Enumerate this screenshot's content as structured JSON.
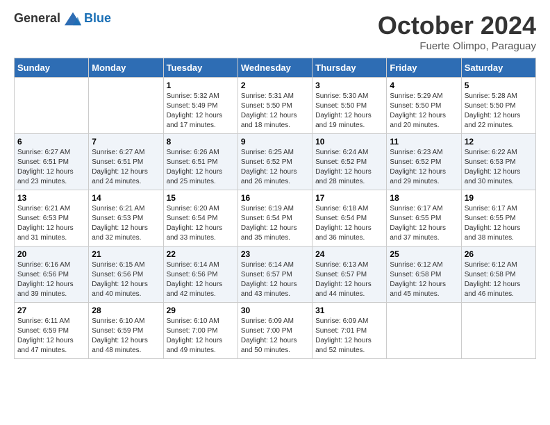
{
  "header": {
    "logo": {
      "general": "General",
      "blue": "Blue"
    },
    "title": "October 2024",
    "location": "Fuerte Olimpo, Paraguay"
  },
  "weekdays": [
    "Sunday",
    "Monday",
    "Tuesday",
    "Wednesday",
    "Thursday",
    "Friday",
    "Saturday"
  ],
  "weeks": [
    [
      {
        "day": "",
        "sunrise": "",
        "sunset": "",
        "daylight": ""
      },
      {
        "day": "",
        "sunrise": "",
        "sunset": "",
        "daylight": ""
      },
      {
        "day": "1",
        "sunrise": "Sunrise: 5:32 AM",
        "sunset": "Sunset: 5:49 PM",
        "daylight": "Daylight: 12 hours and 17 minutes."
      },
      {
        "day": "2",
        "sunrise": "Sunrise: 5:31 AM",
        "sunset": "Sunset: 5:50 PM",
        "daylight": "Daylight: 12 hours and 18 minutes."
      },
      {
        "day": "3",
        "sunrise": "Sunrise: 5:30 AM",
        "sunset": "Sunset: 5:50 PM",
        "daylight": "Daylight: 12 hours and 19 minutes."
      },
      {
        "day": "4",
        "sunrise": "Sunrise: 5:29 AM",
        "sunset": "Sunset: 5:50 PM",
        "daylight": "Daylight: 12 hours and 20 minutes."
      },
      {
        "day": "5",
        "sunrise": "Sunrise: 5:28 AM",
        "sunset": "Sunset: 5:50 PM",
        "daylight": "Daylight: 12 hours and 22 minutes."
      }
    ],
    [
      {
        "day": "6",
        "sunrise": "Sunrise: 6:27 AM",
        "sunset": "Sunset: 6:51 PM",
        "daylight": "Daylight: 12 hours and 23 minutes."
      },
      {
        "day": "7",
        "sunrise": "Sunrise: 6:27 AM",
        "sunset": "Sunset: 6:51 PM",
        "daylight": "Daylight: 12 hours and 24 minutes."
      },
      {
        "day": "8",
        "sunrise": "Sunrise: 6:26 AM",
        "sunset": "Sunset: 6:51 PM",
        "daylight": "Daylight: 12 hours and 25 minutes."
      },
      {
        "day": "9",
        "sunrise": "Sunrise: 6:25 AM",
        "sunset": "Sunset: 6:52 PM",
        "daylight": "Daylight: 12 hours and 26 minutes."
      },
      {
        "day": "10",
        "sunrise": "Sunrise: 6:24 AM",
        "sunset": "Sunset: 6:52 PM",
        "daylight": "Daylight: 12 hours and 28 minutes."
      },
      {
        "day": "11",
        "sunrise": "Sunrise: 6:23 AM",
        "sunset": "Sunset: 6:52 PM",
        "daylight": "Daylight: 12 hours and 29 minutes."
      },
      {
        "day": "12",
        "sunrise": "Sunrise: 6:22 AM",
        "sunset": "Sunset: 6:53 PM",
        "daylight": "Daylight: 12 hours and 30 minutes."
      }
    ],
    [
      {
        "day": "13",
        "sunrise": "Sunrise: 6:21 AM",
        "sunset": "Sunset: 6:53 PM",
        "daylight": "Daylight: 12 hours and 31 minutes."
      },
      {
        "day": "14",
        "sunrise": "Sunrise: 6:21 AM",
        "sunset": "Sunset: 6:53 PM",
        "daylight": "Daylight: 12 hours and 32 minutes."
      },
      {
        "day": "15",
        "sunrise": "Sunrise: 6:20 AM",
        "sunset": "Sunset: 6:54 PM",
        "daylight": "Daylight: 12 hours and 33 minutes."
      },
      {
        "day": "16",
        "sunrise": "Sunrise: 6:19 AM",
        "sunset": "Sunset: 6:54 PM",
        "daylight": "Daylight: 12 hours and 35 minutes."
      },
      {
        "day": "17",
        "sunrise": "Sunrise: 6:18 AM",
        "sunset": "Sunset: 6:54 PM",
        "daylight": "Daylight: 12 hours and 36 minutes."
      },
      {
        "day": "18",
        "sunrise": "Sunrise: 6:17 AM",
        "sunset": "Sunset: 6:55 PM",
        "daylight": "Daylight: 12 hours and 37 minutes."
      },
      {
        "day": "19",
        "sunrise": "Sunrise: 6:17 AM",
        "sunset": "Sunset: 6:55 PM",
        "daylight": "Daylight: 12 hours and 38 minutes."
      }
    ],
    [
      {
        "day": "20",
        "sunrise": "Sunrise: 6:16 AM",
        "sunset": "Sunset: 6:56 PM",
        "daylight": "Daylight: 12 hours and 39 minutes."
      },
      {
        "day": "21",
        "sunrise": "Sunrise: 6:15 AM",
        "sunset": "Sunset: 6:56 PM",
        "daylight": "Daylight: 12 hours and 40 minutes."
      },
      {
        "day": "22",
        "sunrise": "Sunrise: 6:14 AM",
        "sunset": "Sunset: 6:56 PM",
        "daylight": "Daylight: 12 hours and 42 minutes."
      },
      {
        "day": "23",
        "sunrise": "Sunrise: 6:14 AM",
        "sunset": "Sunset: 6:57 PM",
        "daylight": "Daylight: 12 hours and 43 minutes."
      },
      {
        "day": "24",
        "sunrise": "Sunrise: 6:13 AM",
        "sunset": "Sunset: 6:57 PM",
        "daylight": "Daylight: 12 hours and 44 minutes."
      },
      {
        "day": "25",
        "sunrise": "Sunrise: 6:12 AM",
        "sunset": "Sunset: 6:58 PM",
        "daylight": "Daylight: 12 hours and 45 minutes."
      },
      {
        "day": "26",
        "sunrise": "Sunrise: 6:12 AM",
        "sunset": "Sunset: 6:58 PM",
        "daylight": "Daylight: 12 hours and 46 minutes."
      }
    ],
    [
      {
        "day": "27",
        "sunrise": "Sunrise: 6:11 AM",
        "sunset": "Sunset: 6:59 PM",
        "daylight": "Daylight: 12 hours and 47 minutes."
      },
      {
        "day": "28",
        "sunrise": "Sunrise: 6:10 AM",
        "sunset": "Sunset: 6:59 PM",
        "daylight": "Daylight: 12 hours and 48 minutes."
      },
      {
        "day": "29",
        "sunrise": "Sunrise: 6:10 AM",
        "sunset": "Sunset: 7:00 PM",
        "daylight": "Daylight: 12 hours and 49 minutes."
      },
      {
        "day": "30",
        "sunrise": "Sunrise: 6:09 AM",
        "sunset": "Sunset: 7:00 PM",
        "daylight": "Daylight: 12 hours and 50 minutes."
      },
      {
        "day": "31",
        "sunrise": "Sunrise: 6:09 AM",
        "sunset": "Sunset: 7:01 PM",
        "daylight": "Daylight: 12 hours and 52 minutes."
      },
      {
        "day": "",
        "sunrise": "",
        "sunset": "",
        "daylight": ""
      },
      {
        "day": "",
        "sunrise": "",
        "sunset": "",
        "daylight": ""
      }
    ]
  ]
}
